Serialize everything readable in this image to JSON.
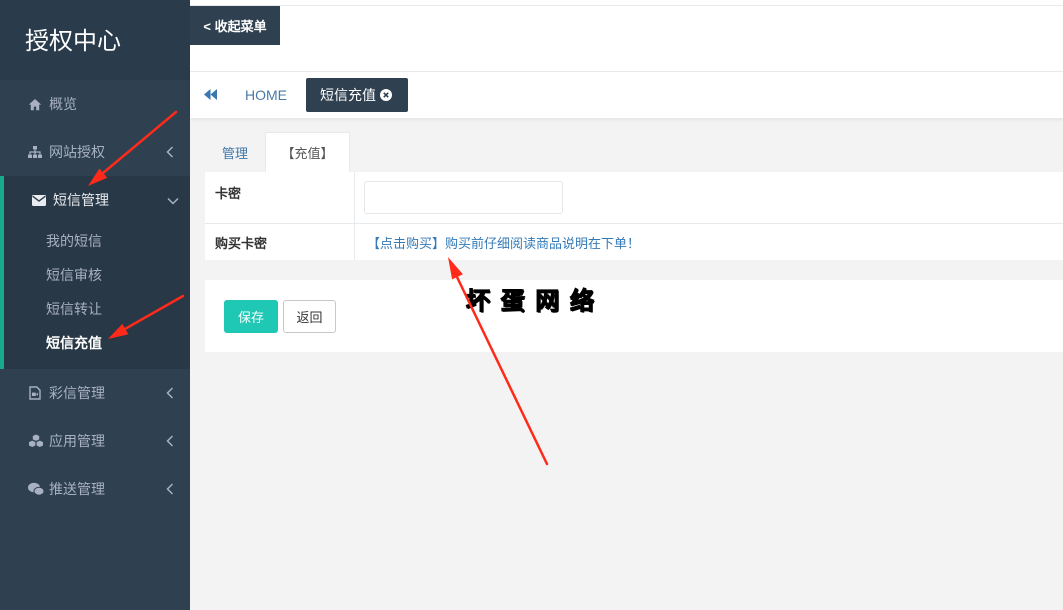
{
  "sidebar": {
    "title": "授权中心",
    "items": [
      {
        "label": "概览",
        "icon": "home-icon"
      },
      {
        "label": "网站授权",
        "icon": "sitemap-icon",
        "chevron": "chevron-left-icon"
      },
      {
        "label": "短信管理",
        "icon": "envelope-icon",
        "chevron": "chevron-down-icon",
        "expanded": true,
        "children": [
          {
            "label": "我的短信"
          },
          {
            "label": "短信审核"
          },
          {
            "label": "短信转让"
          },
          {
            "label": "短信充值",
            "active": true
          }
        ]
      },
      {
        "label": "彩信管理",
        "icon": "file-video-icon",
        "chevron": "chevron-left-icon"
      },
      {
        "label": "应用管理",
        "icon": "cubes-icon",
        "chevron": "chevron-left-icon"
      },
      {
        "label": "推送管理",
        "icon": "wechat-icon",
        "chevron": "chevron-left-icon"
      }
    ]
  },
  "topbar": {
    "collapse_label": "< 收起菜单"
  },
  "tabbar": {
    "back_icon": "backward-icon",
    "home_label": "HOME",
    "active_tab": {
      "label": "短信充值",
      "close_icon": "close-circle-icon"
    }
  },
  "form": {
    "tabs": [
      {
        "label": "管理"
      },
      {
        "label": "【充值】",
        "active": true
      }
    ],
    "rows": [
      {
        "label": "卡密",
        "input_value": ""
      },
      {
        "label": "购买卡密",
        "link": "【点击购买】购买前仔细阅读商品说明在下单！"
      }
    ]
  },
  "actions": {
    "save_label": "保存",
    "back_label": "返回"
  },
  "watermark": "坏 蛋 网 络",
  "colors": {
    "sidebar_bg": "#2f4050",
    "sidebar_active_bg": "#293846",
    "accent": "#19aa8d",
    "primary_button": "#1ec8b5",
    "link": "#337ab7",
    "annotation_arrow": "#ff2a1a",
    "watermark": "#e8171b"
  }
}
